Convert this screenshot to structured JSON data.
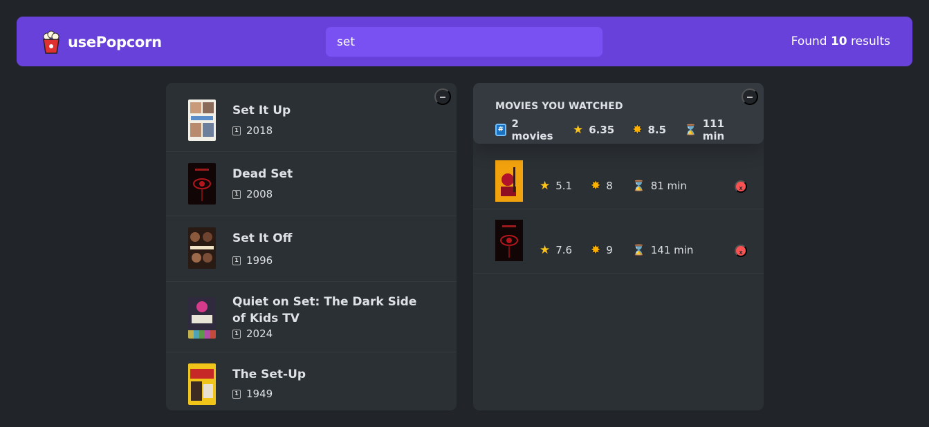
{
  "app": {
    "name": "usePopcorn"
  },
  "search": {
    "value": "set",
    "placeholder": "Search movies..."
  },
  "results": {
    "prefix": "Found",
    "count": "10",
    "suffix": "results"
  },
  "list": {
    "toggle": "–",
    "movies": [
      {
        "title": "Set It Up",
        "year": "2018"
      },
      {
        "title": "Dead Set",
        "year": "2008"
      },
      {
        "title": "Set It Off",
        "year": "1996"
      },
      {
        "title": "Quiet on Set: The Dark Side of Kids TV",
        "year": "2024"
      },
      {
        "title": "The Set-Up",
        "year": "1949"
      }
    ]
  },
  "watched": {
    "toggle": "–",
    "heading": "MOVIES YOU WATCHED",
    "summary": {
      "movies": "2 movies",
      "imdb_avg": "6.35",
      "user_avg": "8.5",
      "runtime_avg": "111 min"
    },
    "movies": [
      {
        "imdb": "5.1",
        "user": "8",
        "runtime": "81 min",
        "delete": "x"
      },
      {
        "imdb": "7.6",
        "user": "9",
        "runtime": "141 min",
        "delete": "x"
      }
    ]
  },
  "icons": {
    "calendar": "calendar-icon",
    "hash": "hashtag-icon",
    "star": "star-icon",
    "glowing_star": "glowing-star-icon",
    "hourglass": "hourglass-icon"
  },
  "colors": {
    "primary": "#6741d9",
    "primary_light": "#7950f2",
    "background": "#212529",
    "box": "#2b3035",
    "delete": "#fa5252"
  }
}
